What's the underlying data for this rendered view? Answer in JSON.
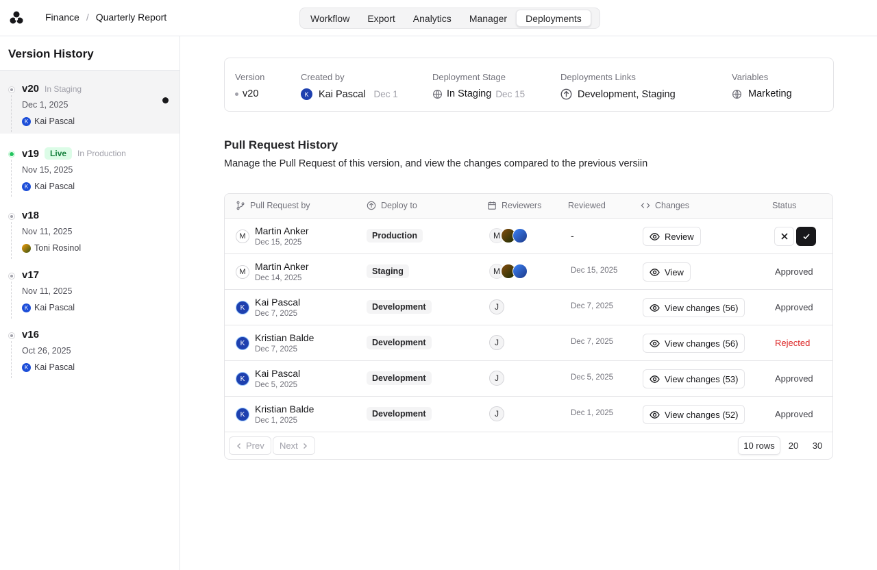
{
  "header": {
    "breadcrumb": [
      "Finance",
      "Quarterly Report"
    ],
    "tabs": [
      "Workflow",
      "Export",
      "Analytics",
      "Manager",
      "Deployments"
    ],
    "active_tab": "Deployments"
  },
  "sidebar": {
    "title": "Version History",
    "versions": [
      {
        "name": "v20",
        "stage": "In Staging",
        "date": "Dec 1, 2025",
        "user": "Kai Pascal",
        "user_initial": "K"
      },
      {
        "name": "v19",
        "badge": "Live",
        "stage": "In Production",
        "date": "Nov 15, 2025",
        "user": "Kai Pascal",
        "user_initial": "K"
      },
      {
        "name": "v18",
        "stage": "",
        "date": "Nov 11, 2025",
        "user": "Toni Rosinol",
        "user_initial": ""
      },
      {
        "name": "v17",
        "stage": "",
        "date": "Nov 11, 2025",
        "user": "Kai Pascal",
        "user_initial": "K"
      },
      {
        "name": "v16",
        "stage": "",
        "date": "Oct 26, 2025",
        "user": "Kai Pascal",
        "user_initial": "K"
      }
    ]
  },
  "info": {
    "version_label": "Version",
    "version_value": "v20",
    "created_label": "Created by",
    "created_initial": "K",
    "created_user": "Kai Pascal",
    "created_date": "Dec 1",
    "stage_label": "Deployment Stage",
    "stage_value": "In Staging",
    "stage_date": "Dec 15",
    "links_label": "Deployments Links",
    "links_value": "Development, Staging",
    "vars_label": "Variables",
    "vars_value": "Marketing"
  },
  "pr": {
    "title": "Pull Request History",
    "description": "Manage the Pull Request of this version, and view the changes compared to the previous versiin",
    "columns": [
      "Pull Request by",
      "Deploy to",
      "Reviewers",
      "Reviewed",
      "Changes",
      "Status"
    ],
    "rows": [
      {
        "initial": "M",
        "name": "Martin Anker",
        "date": "Dec 15, 2025",
        "deploy": "Production",
        "reviewed": "-",
        "changes": "Review",
        "status": ""
      },
      {
        "initial": "M",
        "name": "Martin Anker",
        "date": "Dec 14, 2025",
        "deploy": "Staging",
        "reviewed": "Dec 15, 2025",
        "changes": "View",
        "status": "Approved"
      },
      {
        "initial": "K",
        "name": "Kai Pascal",
        "date": "Dec 7, 2025",
        "deploy": "Development",
        "reviewed": "Dec 7, 2025",
        "changes": "View changes (56)",
        "status": "Approved"
      },
      {
        "initial": "K",
        "name": "Kristian Balde",
        "date": "Dec 7, 2025",
        "deploy": "Development",
        "reviewed": "Dec 7, 2025",
        "changes": "View changes (56)",
        "status": "Rejected"
      },
      {
        "initial": "K",
        "name": "Kai Pascal",
        "date": "Dec 5, 2025",
        "deploy": "Development",
        "reviewed": "Dec 5, 2025",
        "changes": "View changes (53)",
        "status": "Approved"
      },
      {
        "initial": "K",
        "name": "Kristian Balde",
        "date": "Dec 1, 2025",
        "deploy": "Development",
        "reviewed": "Dec 1, 2025",
        "changes": "View changes (52)",
        "status": "Approved"
      }
    ],
    "reviewer_initials": [
      "M",
      "",
      "",
      "J",
      "J",
      "J",
      "J"
    ],
    "prev_label": "Prev",
    "next_label": "Next",
    "row_options": [
      "10 rows",
      "20",
      "30"
    ],
    "colors": {
      "rejected": "#dc2626",
      "live": "#22c55e",
      "avatar": "#1e40af"
    }
  }
}
